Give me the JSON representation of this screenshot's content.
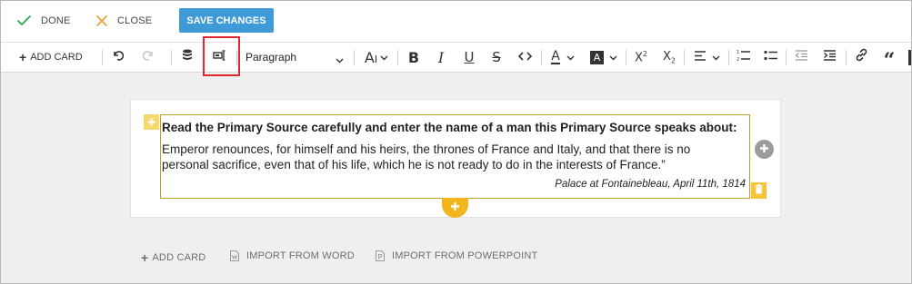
{
  "header": {
    "done_label": "DONE",
    "close_label": "CLOSE",
    "save_label": "SAVE CHANGES"
  },
  "toolbar": {
    "add_card_label": "ADD CARD",
    "paragraph_value": "Paragraph",
    "highlight_color": "#e0262e"
  },
  "question": {
    "prompt": "Read the Primary Source carefully and enter the name of a man this Primary Source speaks about:",
    "quote_line1": "Emperor renounces, for himself and his heirs, the thrones of France and Italy, and that there is no",
    "quote_line2": "personal sacrifice, even that of his life, which he is not ready to do in the interests of France.”",
    "source": "Palace at Fontainebleau, April 11th, 1814"
  },
  "bottom": {
    "add_card_label": "ADD CARD",
    "import_word_label": "IMPORT FROM WORD",
    "import_ppt_label": "IMPORT FROM POWERPOINT"
  },
  "colors": {
    "accent": "#3f9ad8",
    "done_check": "#2fa84f",
    "close_x": "#e8a33d",
    "block_border": "#b8a42a",
    "add_tab": "#f2b51d"
  }
}
